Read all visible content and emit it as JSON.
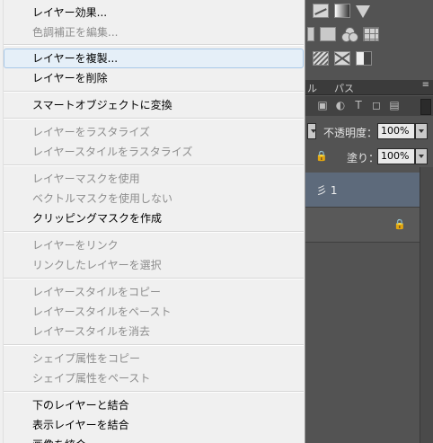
{
  "menu": {
    "items": [
      {
        "label": "レイヤー効果...",
        "enabled": true
      },
      {
        "label": "色調補正を編集...",
        "enabled": false
      },
      {
        "label": "レイヤーを複製...",
        "enabled": true,
        "hover": true
      },
      {
        "label": "レイヤーを削除",
        "enabled": true
      },
      {
        "label": "スマートオブジェクトに変換",
        "enabled": true
      },
      {
        "label": "レイヤーをラスタライズ",
        "enabled": false
      },
      {
        "label": "レイヤースタイルをラスタライズ",
        "enabled": false
      },
      {
        "label": "レイヤーマスクを使用",
        "enabled": false
      },
      {
        "label": "ベクトルマスクを使用しない",
        "enabled": false
      },
      {
        "label": "クリッピングマスクを作成",
        "enabled": true
      },
      {
        "label": "レイヤーをリンク",
        "enabled": false
      },
      {
        "label": "リンクしたレイヤーを選択",
        "enabled": false
      },
      {
        "label": "レイヤースタイルをコピー",
        "enabled": false
      },
      {
        "label": "レイヤースタイルをペースト",
        "enabled": false
      },
      {
        "label": "レイヤースタイルを消去",
        "enabled": false
      },
      {
        "label": "シェイプ属性をコピー",
        "enabled": false
      },
      {
        "label": "シェイプ属性をペースト",
        "enabled": false
      },
      {
        "label": "下のレイヤーと結合",
        "enabled": true
      },
      {
        "label": "表示レイヤーを結合",
        "enabled": true
      },
      {
        "label": "画像を統合",
        "enabled": true
      }
    ]
  },
  "panel": {
    "tab_partial": "ル",
    "tab_paths": "パス",
    "tab_menu_glyph": "≡",
    "opacity_label": "不透明度：",
    "opacity_value": "100%",
    "fill_label": "塗り：",
    "fill_value": "100%",
    "lock_glyph": "🔒",
    "selected_layer_partial": "彡 1",
    "filter_T": "T",
    "colors": {
      "selected_layer": "#5d6a7b",
      "panel_bg": "#535353"
    }
  }
}
